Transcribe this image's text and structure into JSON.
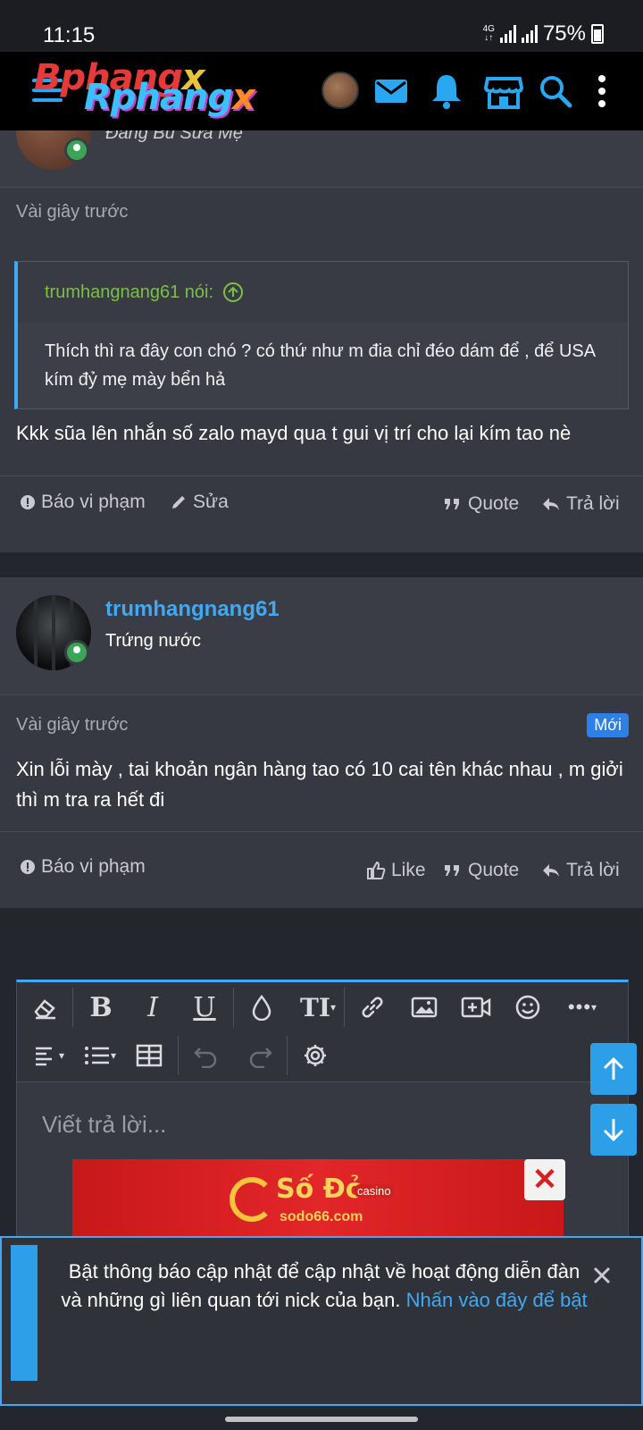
{
  "status_bar": {
    "time": "11:15",
    "network": "4G",
    "battery": "75%"
  },
  "header": {
    "logo_line1_a": "Bphang",
    "logo_line1_b": "x",
    "logo_line2_a": "Rphang",
    "logo_line2_b": "x",
    "icons": [
      "menu-icon",
      "avatar",
      "mail-icon",
      "bell-icon",
      "store-icon",
      "search-icon",
      "more-icon"
    ],
    "accent_color": "#29a7f0"
  },
  "post1": {
    "user_title": "Đang Bú Sữa Mẹ",
    "time": "Vài giây trước",
    "quote_author": "trumhangnang61 nói:",
    "quote_text": "Thích thì ra đây con chó ? có thứ như m đia chỉ đéo dám để , để USA kím đỷ mẹ mày bển hả",
    "message": "Kkk sũa lên nhắn số zalo mayd qua t gui vị trí cho lại kím tao nè",
    "actions": {
      "report": "Báo vi phạm",
      "edit": "Sửa",
      "quote": "Quote",
      "reply": "Trả lời"
    }
  },
  "post2": {
    "username": "trumhangnang61",
    "user_title": "Trứng nước",
    "time": "Vài giây trước",
    "badge": "Mới",
    "message": "Xin lỗi mày , tai khoản ngân hàng tao có 10 cai tên khác nhau , m giởi thì m tra ra hết đi",
    "actions": {
      "report": "Báo vi phạm",
      "like": "Like",
      "quote": "Quote",
      "reply": "Trả lời"
    }
  },
  "editor": {
    "placeholder": "Viết trả lời...",
    "toolbar_row1": [
      "eraser-icon",
      "bold-icon",
      "italic-icon",
      "underline-icon",
      "color-icon",
      "font-size-icon",
      "link-icon",
      "image-icon",
      "video-icon",
      "emoji-icon",
      "more-options-icon"
    ],
    "toolbar_row2": [
      "align-icon",
      "list-icon",
      "table-icon",
      "undo-icon",
      "redo-icon",
      "settings-icon"
    ]
  },
  "ad": {
    "brand": "Số Đỏ",
    "tag": "casino",
    "url": "sodo66.com"
  },
  "notice": {
    "text": "Bật thông báo cập nhật để cập nhật về hoạt động diễn đàn và những gì liên quan tới nick của bạn.",
    "link": "Nhấn vào đây để bật"
  }
}
